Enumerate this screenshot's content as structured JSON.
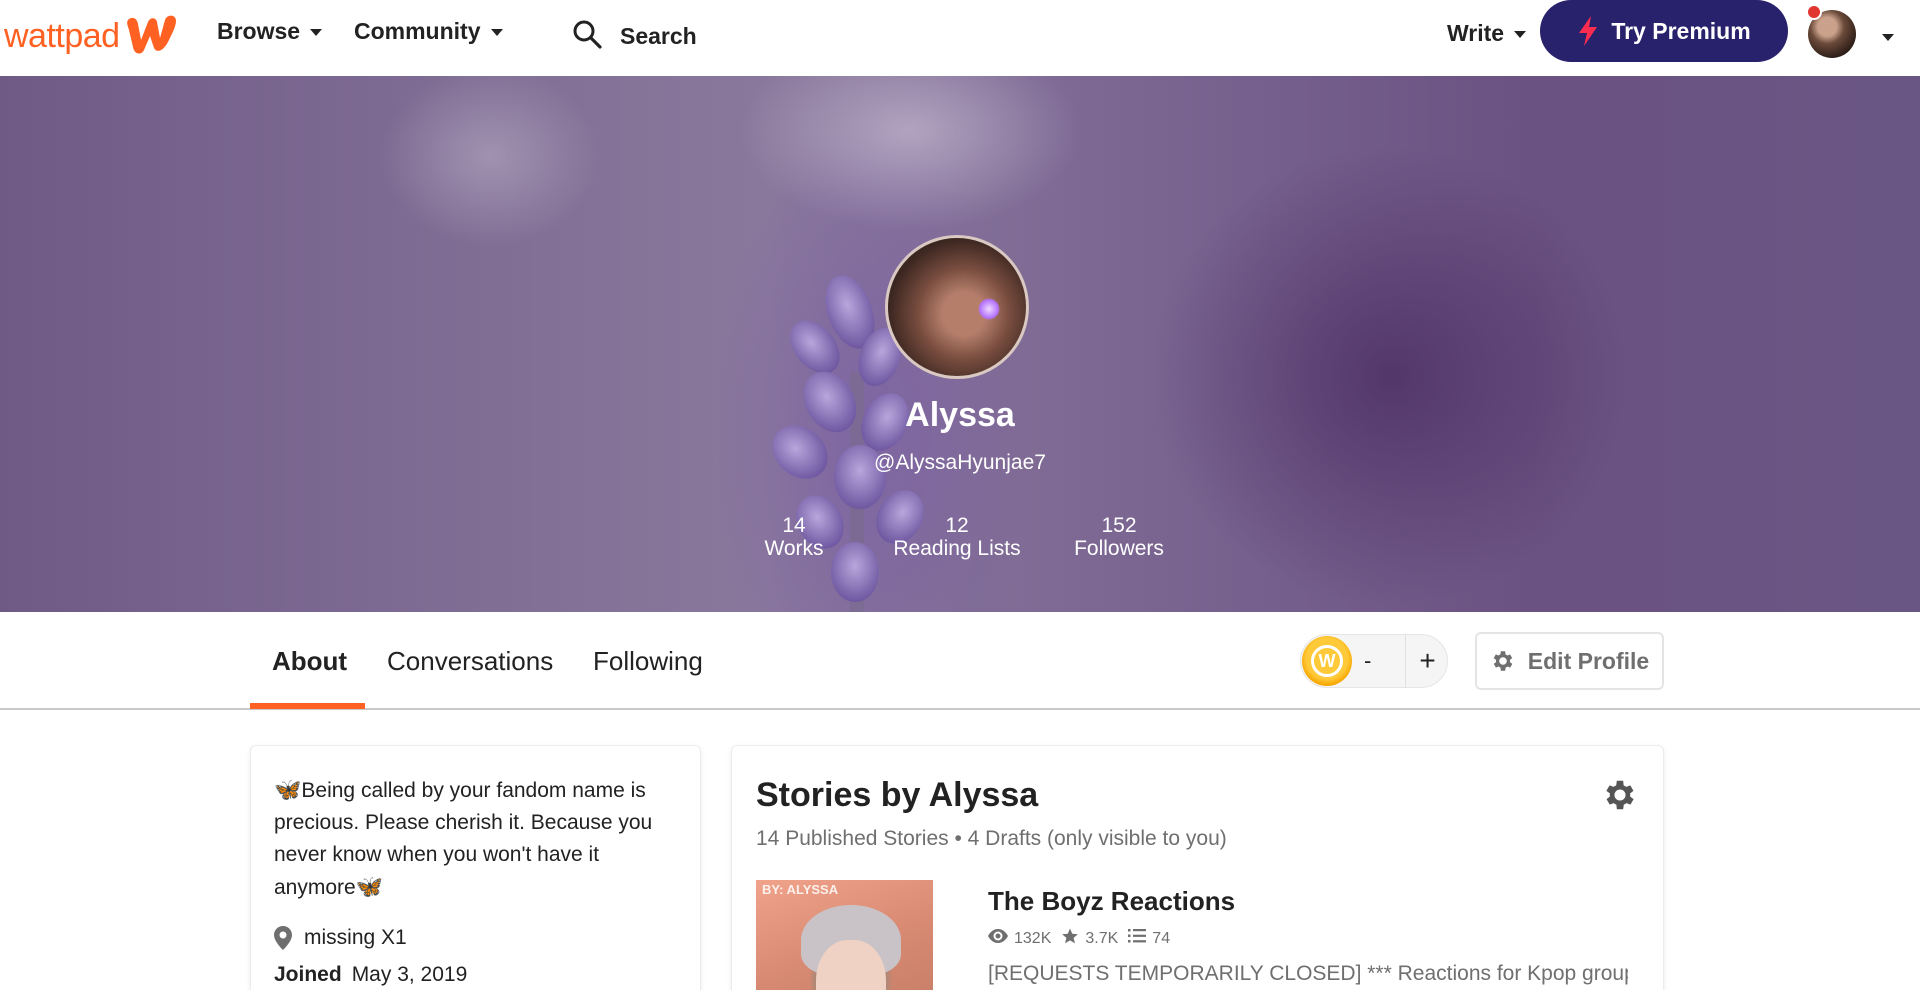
{
  "nav": {
    "logo_text": "wattpad",
    "browse": "Browse",
    "community": "Community",
    "search_placeholder": "Search",
    "write": "Write",
    "premium": "Try Premium"
  },
  "profile": {
    "name": "Alyssa",
    "handle": "@AlyssaHyunjae7",
    "stats": [
      {
        "value": "14",
        "label": "Works"
      },
      {
        "value": "12",
        "label": "Reading Lists"
      },
      {
        "value": "152",
        "label": "Followers"
      }
    ]
  },
  "tabs": {
    "about": "About",
    "conversations": "Conversations",
    "following": "Following"
  },
  "coins": {
    "count": "-",
    "plus": "+"
  },
  "edit_profile": "Edit Profile",
  "about": {
    "bio": "Being called by your fandom name is precious. Please cherish it. Because you never know when you won't have it anymore",
    "butterfly": "🦋",
    "location": "missing X1",
    "joined_label": "Joined",
    "joined_date": "May 3, 2019"
  },
  "stories": {
    "title": "Stories by Alyssa",
    "subtitle": "14 Published Stories • 4 Drafts (only visible to you)",
    "items": [
      {
        "cover_label": "BY: ALYSSA",
        "title": "The Boyz Reactions",
        "reads": "132K",
        "votes": "3.7K",
        "parts": "74",
        "description": "[REQUESTS TEMPORARILY CLOSED] *** Reactions for Kpop group,"
      }
    ]
  },
  "colors": {
    "brand": "#ff6122",
    "premium": "#28216b",
    "notification": "#e0362f"
  }
}
